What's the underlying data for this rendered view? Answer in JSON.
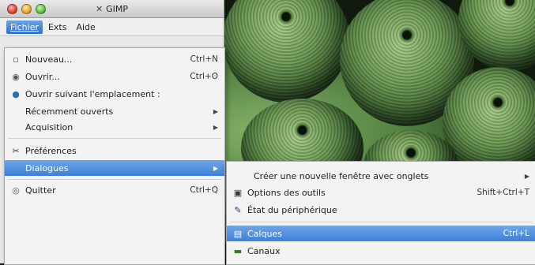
{
  "window": {
    "title": "GIMP",
    "menubar": [
      "Fichier",
      "Exts",
      "Aide"
    ]
  },
  "file_menu": {
    "items": [
      {
        "icon": "new-file-icon",
        "label": "Nouveau...",
        "shortcut": "Ctrl+N"
      },
      {
        "icon": "open-file-icon",
        "label": "Ouvrir...",
        "shortcut": "Ctrl+O"
      },
      {
        "icon": "globe-icon",
        "label": "Ouvrir suivant l'emplacement :",
        "shortcut": ""
      },
      {
        "icon": "",
        "label": "Récemment ouverts",
        "submenu": true
      },
      {
        "icon": "",
        "label": "Acquisition",
        "submenu": true
      },
      {
        "icon": "preferences-icon",
        "label": "Préférences",
        "shortcut": ""
      },
      {
        "icon": "",
        "label": "Dialogues",
        "submenu": true,
        "highlighted": true
      },
      {
        "icon": "quit-icon",
        "label": "Quitter",
        "shortcut": "Ctrl+Q"
      }
    ]
  },
  "dialogs_menu": {
    "items": [
      {
        "icon": "",
        "label": "Créer une nouvelle fenêtre avec onglets",
        "submenu": true
      },
      {
        "icon": "tool-options-icon",
        "label": "Options des outils",
        "shortcut": "Shift+Ctrl+T"
      },
      {
        "icon": "device-status-icon",
        "label": "État du périphérique",
        "shortcut": ""
      },
      {
        "icon": "layers-icon",
        "label": "Calques",
        "shortcut": "Ctrl+L",
        "highlighted": true
      },
      {
        "icon": "channels-icon",
        "label": "Canaux",
        "shortcut": ""
      }
    ]
  }
}
